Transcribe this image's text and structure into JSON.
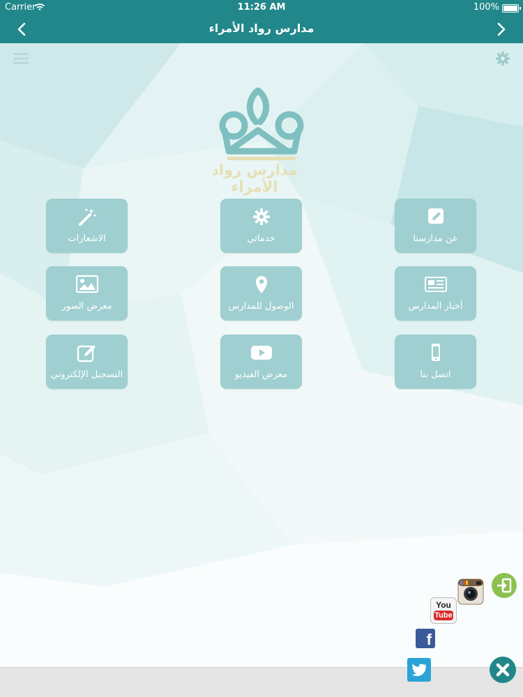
{
  "status_bar": {
    "carrier": "Carrier",
    "time": "11:26 AM",
    "battery": "100%"
  },
  "nav": {
    "title": "مدارس رواد الأمراء",
    "back_icon": "chevron-left-icon",
    "forward_icon": "chevron-right-icon"
  },
  "logo": {
    "text": "مدارس رواد الأمراء",
    "icon": "crown-icon"
  },
  "colors": {
    "primary": "#21878a",
    "tile": "#9fcfd0",
    "logo_gold": "#e6dfb4",
    "logo_teal": "#7fbfc0"
  },
  "grid": {
    "tiles": [
      {
        "label": "عن مدارسنا",
        "icon": "pencil-square-icon"
      },
      {
        "label": "خدماتي",
        "icon": "gear-icon"
      },
      {
        "label": "الاشعارات",
        "icon": "magic-wand-icon"
      },
      {
        "label": "أخبار المدارس",
        "icon": "newspaper-icon"
      },
      {
        "label": "الوصول للمدارس",
        "icon": "map-marker-icon"
      },
      {
        "label": "معرض الصور",
        "icon": "picture-icon"
      },
      {
        "label": "اتصل بنا",
        "icon": "mobile-phone-icon"
      },
      {
        "label": "معرض الفيديو",
        "icon": "video-play-icon"
      },
      {
        "label": "التسجيل الإلكتروني",
        "icon": "edit-form-icon"
      }
    ]
  },
  "social": {
    "youtube": {
      "line1": "You",
      "line2": "Tube"
    },
    "facebook": "f"
  }
}
